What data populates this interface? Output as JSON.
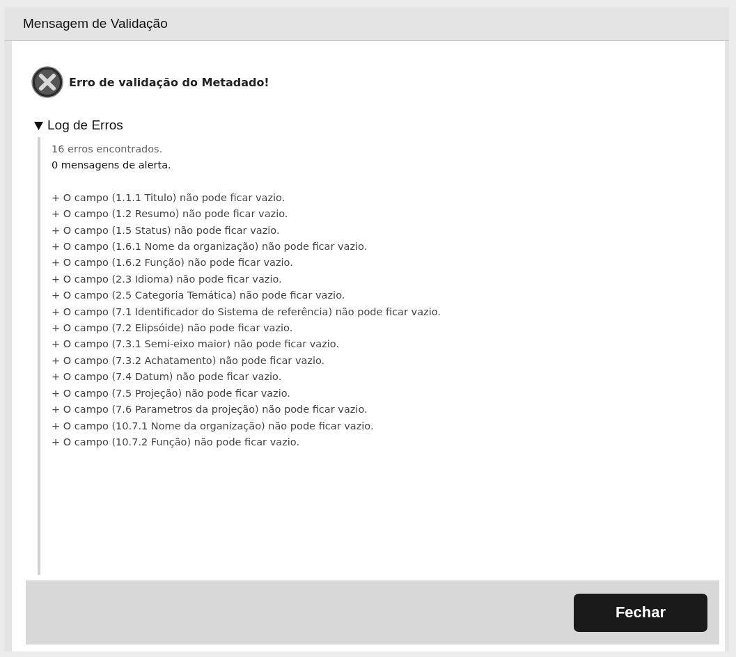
{
  "window": {
    "title": "Mensagem de Validação"
  },
  "message": {
    "kind": "error",
    "text": "Erro de validação do Metadado!"
  },
  "log": {
    "title": "Log de Erros",
    "expanded": true,
    "summary": [
      "16 erros encontrados.",
      "0 mensagens de alerta."
    ],
    "entries": [
      "+ O campo (1.1.1 Titulo) não pode ficar vazio.",
      "+ O campo (1.2 Resumo) não pode ficar vazio.",
      "+ O campo (1.5 Status) não pode ficar vazio.",
      "+ O campo (1.6.1 Nome da organização) não pode ficar vazio.",
      "+ O campo (1.6.2 Função) não pode ficar vazio.",
      "+ O campo (2.3 Idioma) não pode ficar vazio.",
      "+ O campo (2.5 Categoria Temática) não pode ficar vazio.",
      "+ O campo (7.1 Identificador do Sistema de referência) não pode ficar vazio.",
      "+ O campo (7.2 Elipsóide) não pode ficar vazio.",
      "+ O campo (7.3.1 Semi-eixo maior) não pode ficar vazio.",
      "+ O campo (7.3.2 Achatamento) não pode ficar vazio.",
      "+ O campo (7.4 Datum) não pode ficar vazio.",
      "+ O campo (7.5 Projeção) não pode ficar vazio.",
      "+ O campo (7.6 Parametros da projeção) não pode ficar vazio.",
      "+ O campo (10.7.1 Nome da organização) não pode ficar vazio.",
      "+ O campo (10.7.2 Função) não pode ficar vazio."
    ]
  },
  "buttons": [
    "Fechar"
  ]
}
